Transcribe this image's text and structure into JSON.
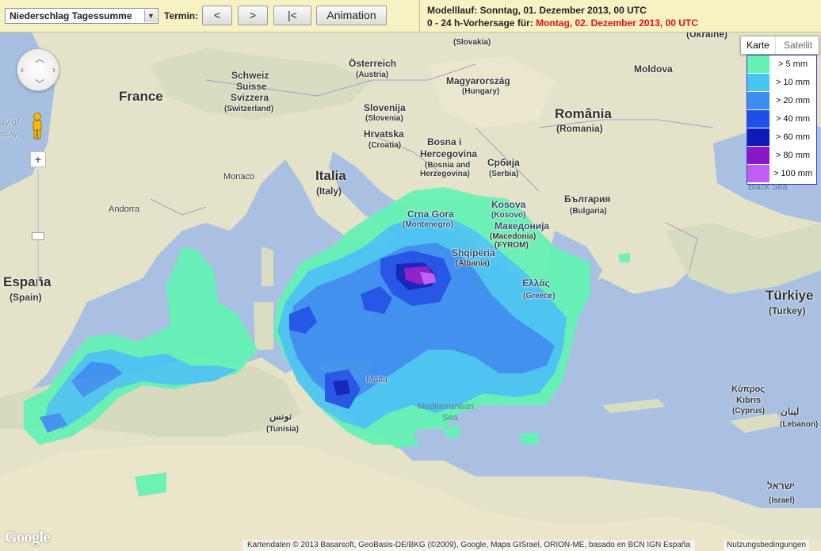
{
  "toolbar": {
    "product_select": "Niederschlag Tagessumme",
    "termin_label": "Termin:",
    "prev_label": "<",
    "next_label": ">",
    "first_label": "|<",
    "animation_label": "Animation",
    "model_run": "Modelllauf: Sonntag, 01. Dezember 2013, 00 UTC",
    "forecast_prefix": "0 - 24 h-Vorhersage für: ",
    "forecast_date": "Montag, 02. Dezember 2013, 00 UTC",
    "forecast_color": "#e01010"
  },
  "map": {
    "maptype": {
      "karte": "Karte",
      "satellite": "Satellit"
    },
    "legend": [
      {
        "label": "> 5 mm",
        "color": "#63f2b4"
      },
      {
        "label": "> 10 mm",
        "color": "#49c5f3"
      },
      {
        "label": "> 20 mm",
        "color": "#3b8ef0"
      },
      {
        "label": "> 40 mm",
        "color": "#1f4fe6"
      },
      {
        "label": "> 60 mm",
        "color": "#0e1bb8"
      },
      {
        "label": "> 80 mm",
        "color": "#8a17c8"
      },
      {
        "label": "> 100 mm",
        "color": "#c15cf6"
      }
    ],
    "labels": {
      "france": "France",
      "espana": "España",
      "spain": "(Spain)",
      "andorra": "Andorra",
      "monaco": "Monaco",
      "schweiz": "Schweiz",
      "suisse": "Suisse",
      "svizzera": "Svizzera",
      "switzerland": "(Switzerland)",
      "osterreich": "Österreich",
      "austria": "(Austria)",
      "italia": "Italia",
      "italy": "(Italy)",
      "slovenija": "Slovenija",
      "slovenia": "(Slovenia)",
      "hrvatska": "Hrvatska",
      "croatia": "(Croatia)",
      "bosna": "Bosna i",
      "hercegovina": "Hercegovina",
      "bosnia": "(Bosnia and",
      "herzegovina": "Herzegovina)",
      "magyarorszag": "Magyarország",
      "hungary": "(Hungary)",
      "slovensko": "(Slovakia)",
      "srbija": "Србија",
      "serbia": "(Serbia)",
      "romania": "România",
      "romania_en": "(Romania)",
      "moldova": "Moldova",
      "ukraine": "(Ukraine)",
      "crna_gora": "Crna Gora",
      "montenegro": "(Montenegro)",
      "kosova": "Kosova",
      "kosovo": "(Kosovo)",
      "makedonija": "Македонија",
      "macedonia": "(Macedonia)",
      "fyrom": "(FYROM)",
      "shqiperia": "Shqipëria",
      "albania": "(Albania)",
      "bulgaria": "България",
      "bulgaria_en": "(Bulgaria)",
      "ellas": "Ελλάς",
      "greece": "(Greece)",
      "turkiye": "Türkiye",
      "turkey": "(Turkey)",
      "black_sea": "Black Sea",
      "tunisia_ar": "تونس",
      "tunisia": "(Tunisia)",
      "malta": "Malta",
      "mediterranean": "Mediterranean",
      "sea": "Sea",
      "kypros": "Κύπρος",
      "kibris": "Kıbrıs",
      "cyprus": "(Cyprus)",
      "lebanon_ar": "لبنان",
      "lebanon": "(Lebanon)",
      "israel_he": "ישראל",
      "israel": "(Israel)",
      "bay_of": "ay of",
      "biscay": "scay"
    },
    "attribution": "Kartendaten © 2013 Basarsoft, GeoBasis-DE/BKG (©2009), Google, Mapa GISrael, ORION-ME, basado en BCN IGN España",
    "terms": "Nutzungsbedingungen",
    "google": "Google"
  }
}
